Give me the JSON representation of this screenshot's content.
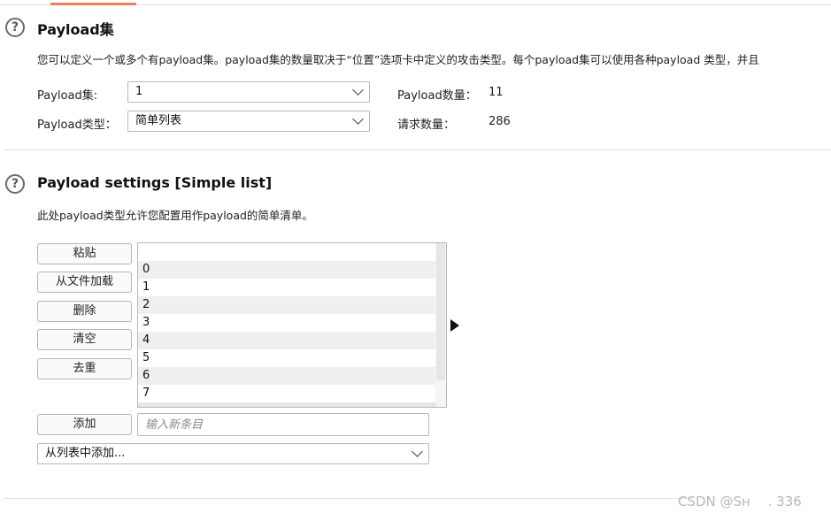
{
  "payload_sets": {
    "help_icon": "?",
    "title": "Payload集",
    "description": "您可以定义一个或多个有payload集。payload集的数量取决于“位置”选项卡中定义的攻击类型。每个payload集可以使用各种payload 类型，并且",
    "set_label": "Payload集:",
    "set_value": "1",
    "type_label": "Payload类型：",
    "type_value": "简单列表",
    "count_label": "Payload数量：",
    "count_value": "11",
    "requests_label": "请求数量：",
    "requests_value": "286"
  },
  "payload_settings": {
    "help_icon": "?",
    "title": "Payload settings [Simple list]",
    "description": "此处payload类型允许您配置用作payload的简单清单。",
    "buttons": {
      "paste": "粘贴",
      "load": "从文件加载",
      "remove": "删除",
      "clear": "清空",
      "dedupe": "去重",
      "add": "添加"
    },
    "list_items": [
      "0",
      "1",
      "2",
      "3",
      "4",
      "5",
      "6",
      "7"
    ],
    "new_item_placeholder": "输入新条目",
    "add_from_list": "从列表中添加..."
  },
  "icons": {
    "help": "help-circle-icon",
    "dropdown": "chevron-down-icon",
    "expand": "triangle-right-icon"
  },
  "colors": {
    "accent_tab": "#e8825a"
  },
  "watermark": "CSDN @Sн　 .  336"
}
